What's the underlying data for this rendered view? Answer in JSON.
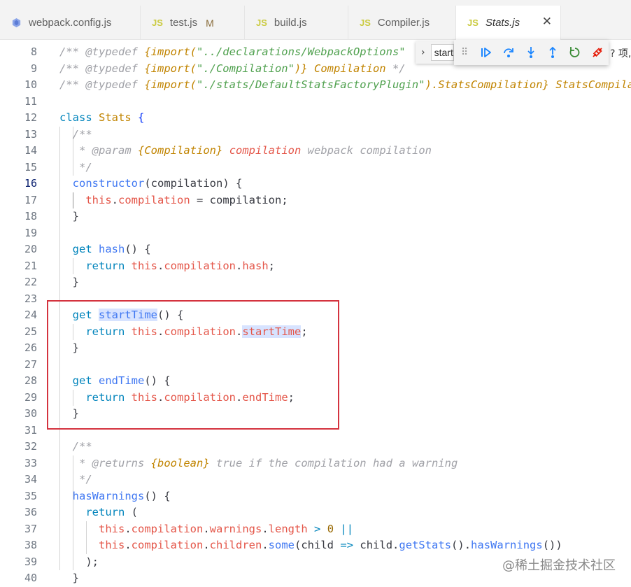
{
  "tabs": [
    {
      "name": "webpack.config.js",
      "icon": "settings-file-icon",
      "modified": "",
      "active": false
    },
    {
      "name": "test.js",
      "icon": "js-icon",
      "badge": "JS",
      "modified": "M",
      "active": false
    },
    {
      "name": "build.js",
      "icon": "js-icon",
      "badge": "JS",
      "modified": "",
      "active": false
    },
    {
      "name": "Compiler.js",
      "icon": "js-icon",
      "badge": "JS",
      "modified": "",
      "active": false
    },
    {
      "name": "Stats.js",
      "icon": "js-icon",
      "badge": "JS",
      "modified": "",
      "active": true,
      "close": "✕"
    }
  ],
  "find_widget": {
    "chevron": "›",
    "value": "start"
  },
  "debug_toolbar": {
    "grip": "⠿",
    "buttons": [
      "continue-icon",
      "step-over-icon",
      "step-into-icon",
      "step-out-icon",
      "restart-icon",
      "disconnect-icon"
    ]
  },
  "overflow_hint": "? 项,",
  "watermark": "@稀土掘金技术社区",
  "editor": {
    "current_line": 16,
    "line_numbers": [
      "8",
      "9",
      "10",
      "11",
      "12",
      "13",
      "14",
      "15",
      "16",
      "17",
      "18",
      "19",
      "20",
      "21",
      "22",
      "23",
      "24",
      "25",
      "26",
      "27",
      "28",
      "29",
      "30",
      "31",
      "32",
      "33",
      "34",
      "35",
      "36",
      "37",
      "38",
      "39",
      "40"
    ],
    "lines": [
      [
        [
          "c-com",
          "/** "
        ],
        [
          "c-tag",
          "@typedef"
        ],
        [
          "c-com",
          " "
        ],
        [
          "c-imp",
          "{import("
        ],
        [
          "c-str",
          "\"../declarations/WebpackOptions\""
        ]
      ],
      [
        [
          "c-com",
          "/** "
        ],
        [
          "c-tag",
          "@typedef"
        ],
        [
          "c-com",
          " "
        ],
        [
          "c-imp",
          "{import("
        ],
        [
          "c-str",
          "\"./Compilation\""
        ],
        [
          "c-imp",
          ")}"
        ],
        [
          "c-com",
          " "
        ],
        [
          "c-type",
          "Compilation"
        ],
        [
          "c-com",
          " */"
        ]
      ],
      [
        [
          "c-com",
          "/** "
        ],
        [
          "c-tag",
          "@typedef"
        ],
        [
          "c-com",
          " "
        ],
        [
          "c-imp",
          "{import("
        ],
        [
          "c-str",
          "\"./stats/DefaultStatsFactoryPlugin\""
        ],
        [
          "c-imp",
          ").StatsCompilation}"
        ],
        [
          "c-com",
          " "
        ],
        [
          "c-type",
          "StatsCompilation"
        ]
      ],
      [],
      [
        [
          "c-kw",
          "class"
        ],
        [
          "c-punc",
          " "
        ],
        [
          "c-cls",
          "Stats"
        ],
        [
          "c-punc",
          " "
        ],
        [
          "c-brace",
          "{"
        ]
      ],
      [
        [
          "c-com",
          "  /**"
        ]
      ],
      [
        [
          "c-com",
          "   * "
        ],
        [
          "c-tag",
          "@param"
        ],
        [
          "c-com",
          " "
        ],
        [
          "c-type",
          "{Compilation}"
        ],
        [
          "c-com",
          " "
        ],
        [
          "c-param",
          "compilation"
        ],
        [
          "c-com",
          " webpack compilation"
        ]
      ],
      [
        [
          "c-com",
          "   */"
        ]
      ],
      [
        [
          "c-punc",
          "  "
        ],
        [
          "c-fn",
          "constructor"
        ],
        [
          "c-punc",
          "("
        ],
        [
          "c-var",
          "compilation"
        ],
        [
          "c-punc",
          ") {"
        ]
      ],
      [
        [
          "c-punc",
          "    "
        ],
        [
          "c-this",
          "this"
        ],
        [
          "c-punc",
          "."
        ],
        [
          "c-prop",
          "compilation"
        ],
        [
          "c-punc",
          " = "
        ],
        [
          "c-var",
          "compilation"
        ],
        [
          "c-punc",
          ";"
        ]
      ],
      [
        [
          "c-punc",
          "  }"
        ]
      ],
      [],
      [
        [
          "c-punc",
          "  "
        ],
        [
          "c-kw",
          "get"
        ],
        [
          "c-punc",
          " "
        ],
        [
          "c-fn",
          "hash"
        ],
        [
          "c-punc",
          "() {"
        ]
      ],
      [
        [
          "c-punc",
          "    "
        ],
        [
          "c-kw",
          "return"
        ],
        [
          "c-punc",
          " "
        ],
        [
          "c-this",
          "this"
        ],
        [
          "c-punc",
          "."
        ],
        [
          "c-prop",
          "compilation"
        ],
        [
          "c-punc",
          "."
        ],
        [
          "c-prop",
          "hash"
        ],
        [
          "c-punc",
          ";"
        ]
      ],
      [
        [
          "c-punc",
          "  }"
        ]
      ],
      [],
      [
        [
          "c-punc",
          "  "
        ],
        [
          "c-kw",
          "get"
        ],
        [
          "c-punc",
          " "
        ],
        [
          "c-fn hl",
          "startTime"
        ],
        [
          "c-punc",
          "() {"
        ]
      ],
      [
        [
          "c-punc",
          "    "
        ],
        [
          "c-kw",
          "return"
        ],
        [
          "c-punc",
          " "
        ],
        [
          "c-this",
          "this"
        ],
        [
          "c-punc",
          "."
        ],
        [
          "c-prop",
          "compilation"
        ],
        [
          "c-punc",
          "."
        ],
        [
          "c-prop hl",
          "startTime"
        ],
        [
          "c-punc",
          ";"
        ]
      ],
      [
        [
          "c-punc",
          "  }"
        ]
      ],
      [],
      [
        [
          "c-punc",
          "  "
        ],
        [
          "c-kw",
          "get"
        ],
        [
          "c-punc",
          " "
        ],
        [
          "c-fn",
          "endTime"
        ],
        [
          "c-punc",
          "() {"
        ]
      ],
      [
        [
          "c-punc",
          "    "
        ],
        [
          "c-kw",
          "return"
        ],
        [
          "c-punc",
          " "
        ],
        [
          "c-this",
          "this"
        ],
        [
          "c-punc",
          "."
        ],
        [
          "c-prop",
          "compilation"
        ],
        [
          "c-punc",
          "."
        ],
        [
          "c-prop",
          "endTime"
        ],
        [
          "c-punc",
          ";"
        ]
      ],
      [
        [
          "c-punc",
          "  }"
        ]
      ],
      [],
      [
        [
          "c-com",
          "  /**"
        ]
      ],
      [
        [
          "c-com",
          "   * "
        ],
        [
          "c-tag",
          "@returns"
        ],
        [
          "c-com",
          " "
        ],
        [
          "c-type",
          "{boolean}"
        ],
        [
          "c-com",
          " true if the compilation had a warning"
        ]
      ],
      [
        [
          "c-com",
          "   */"
        ]
      ],
      [
        [
          "c-punc",
          "  "
        ],
        [
          "c-fn",
          "hasWarnings"
        ],
        [
          "c-punc",
          "() {"
        ]
      ],
      [
        [
          "c-punc",
          "    "
        ],
        [
          "c-kw",
          "return"
        ],
        [
          "c-punc",
          " ("
        ]
      ],
      [
        [
          "c-punc",
          "      "
        ],
        [
          "c-this",
          "this"
        ],
        [
          "c-punc",
          "."
        ],
        [
          "c-prop",
          "compilation"
        ],
        [
          "c-punc",
          "."
        ],
        [
          "c-prop",
          "warnings"
        ],
        [
          "c-punc",
          "."
        ],
        [
          "c-prop",
          "length"
        ],
        [
          "c-punc",
          " "
        ],
        [
          "c-op",
          ">"
        ],
        [
          "c-punc",
          " "
        ],
        [
          "c-num",
          "0"
        ],
        [
          "c-punc",
          " "
        ],
        [
          "c-op",
          "||"
        ]
      ],
      [
        [
          "c-punc",
          "      "
        ],
        [
          "c-this",
          "this"
        ],
        [
          "c-punc",
          "."
        ],
        [
          "c-prop",
          "compilation"
        ],
        [
          "c-punc",
          "."
        ],
        [
          "c-prop",
          "children"
        ],
        [
          "c-punc",
          "."
        ],
        [
          "c-fn",
          "some"
        ],
        [
          "c-punc",
          "("
        ],
        [
          "c-var",
          "child"
        ],
        [
          "c-punc",
          " "
        ],
        [
          "c-op",
          "=>"
        ],
        [
          "c-punc",
          " "
        ],
        [
          "c-var",
          "child"
        ],
        [
          "c-punc",
          "."
        ],
        [
          "c-fn",
          "getStats"
        ],
        [
          "c-punc",
          "()."
        ],
        [
          "c-fn",
          "hasWarnings"
        ],
        [
          "c-punc",
          "())"
        ]
      ],
      [
        [
          "c-punc",
          "    );"
        ]
      ],
      [
        [
          "c-punc",
          "  }"
        ]
      ]
    ]
  }
}
